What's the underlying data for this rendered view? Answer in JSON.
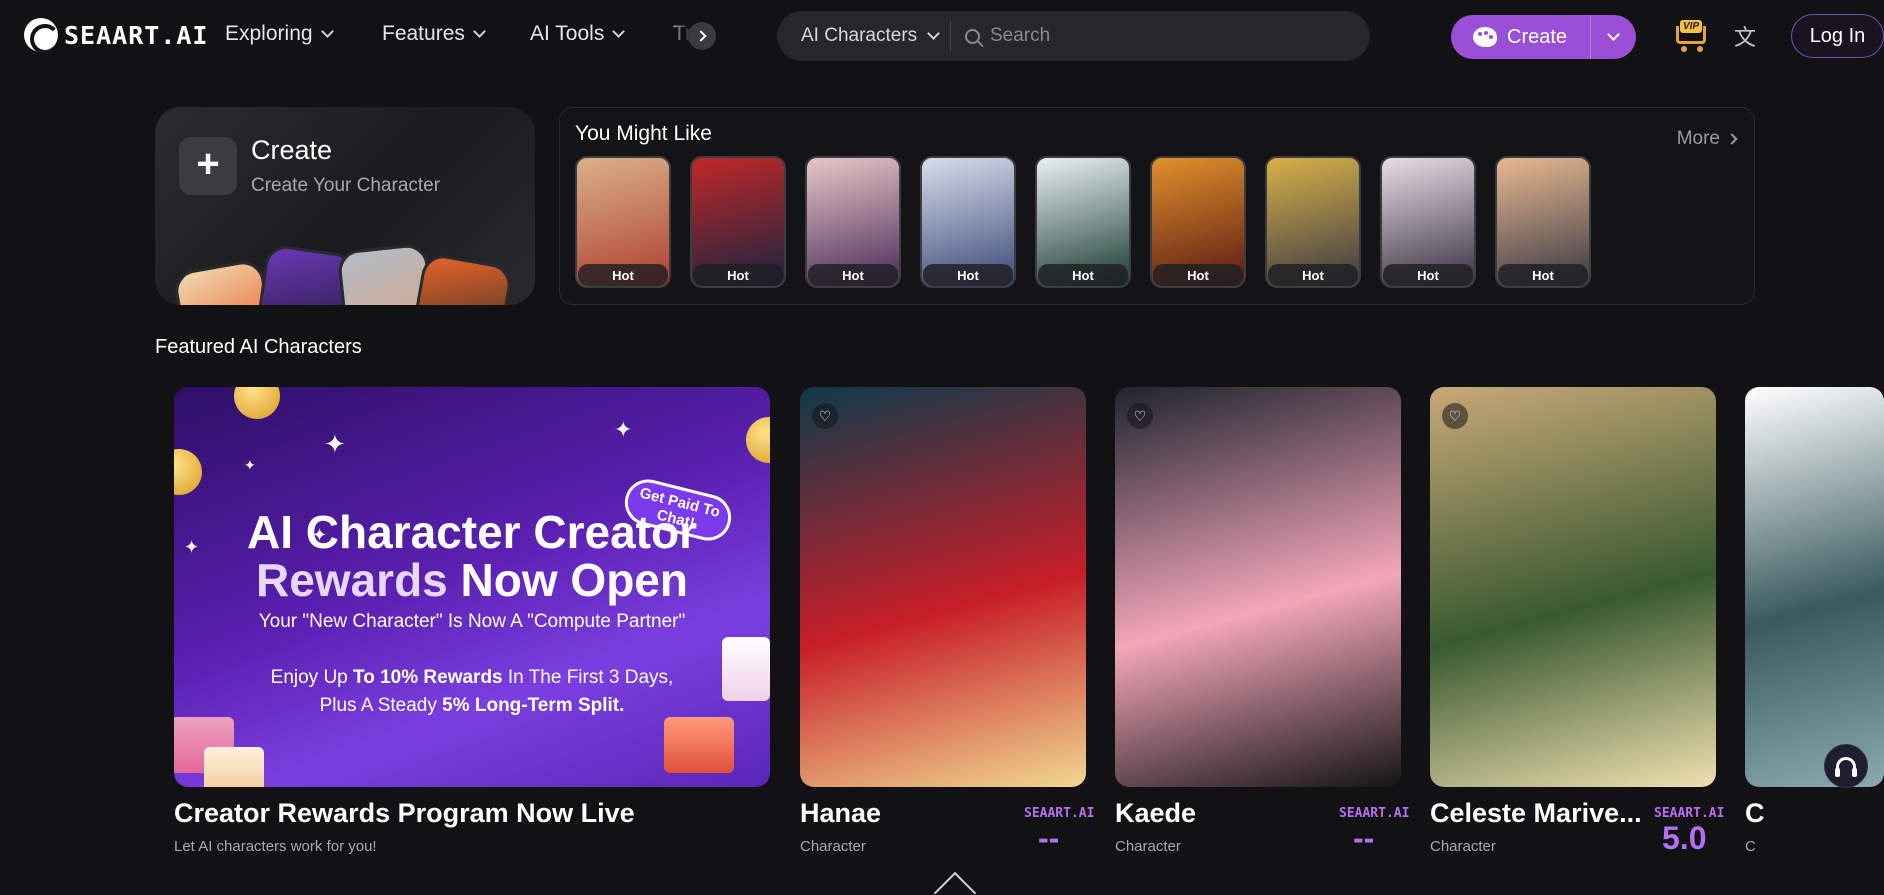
{
  "header": {
    "logo_text": "SEAART.AI",
    "nav": [
      "Exploring",
      "Features",
      "AI Tools",
      "Tr"
    ],
    "search_category": "AI Characters",
    "search_placeholder": "Search",
    "create_label": "Create",
    "vip_label": "VIP",
    "login_label": "Log In"
  },
  "create_card": {
    "title": "Create",
    "subtitle": "Create Your Character"
  },
  "you_might_like": {
    "title": "You Might Like",
    "more_label": "More",
    "items": [
      {
        "badge": "Hot",
        "colors": [
          "#d9b08a",
          "#b04030"
        ]
      },
      {
        "badge": "Hot",
        "colors": [
          "#c02828",
          "#1a2440"
        ]
      },
      {
        "badge": "Hot",
        "colors": [
          "#e8c6c6",
          "#4a2a5a"
        ]
      },
      {
        "badge": "Hot",
        "colors": [
          "#d8dcea",
          "#3a4a78"
        ]
      },
      {
        "badge": "Hot",
        "colors": [
          "#e8f0f0",
          "#1a3a30"
        ]
      },
      {
        "badge": "Hot",
        "colors": [
          "#e0902a",
          "#5a1a14"
        ]
      },
      {
        "badge": "Hot",
        "colors": [
          "#d8b048",
          "#3a3a44"
        ]
      },
      {
        "badge": "Hot",
        "colors": [
          "#e6dde6",
          "#3a3040"
        ]
      },
      {
        "badge": "Hot",
        "colors": [
          "#e8b890",
          "#3a3a44"
        ]
      }
    ]
  },
  "featured": {
    "section_title": "Featured AI Characters",
    "banner": {
      "line1a": "AI Character",
      "line1b": "Creator",
      "line2a": "Rewards",
      "line2b": "Now Open",
      "line3": "Your \"New Character\" Is Now A \"Compute Partner\"",
      "line4a": "Enjoy Up",
      "line4b": "To 10% Rewards",
      "line4c": "In The First 3 Days,",
      "line5a": "Plus A Steady",
      "line5b": "5% Long-Term Split.",
      "badge": "Get Paid To Chat!",
      "title": "Creator Rewards Program Now Live",
      "subtitle": "Let AI characters work for you!"
    },
    "characters": [
      {
        "name": "Hanae",
        "type": "Character",
        "brand": "SEAART.AI",
        "rating": "--",
        "colors": [
          "#0e3a4a",
          "#c81e28",
          "#f0d890"
        ]
      },
      {
        "name": "Kaede",
        "type": "Character",
        "brand": "SEAART.AI",
        "rating": "--",
        "colors": [
          "#202430",
          "#f2a6b8",
          "#151515"
        ]
      },
      {
        "name": "Celeste Marive...",
        "type": "Character",
        "brand": "SEAART.AI",
        "rating": "5.0",
        "colors": [
          "#c8a878",
          "#3a5a30",
          "#f0e0b0"
        ]
      },
      {
        "name": "C",
        "type": "C",
        "colors": [
          "#ffffff",
          "#3a5a60",
          "#88aab0"
        ]
      }
    ]
  },
  "accent": "#9a4fd6"
}
